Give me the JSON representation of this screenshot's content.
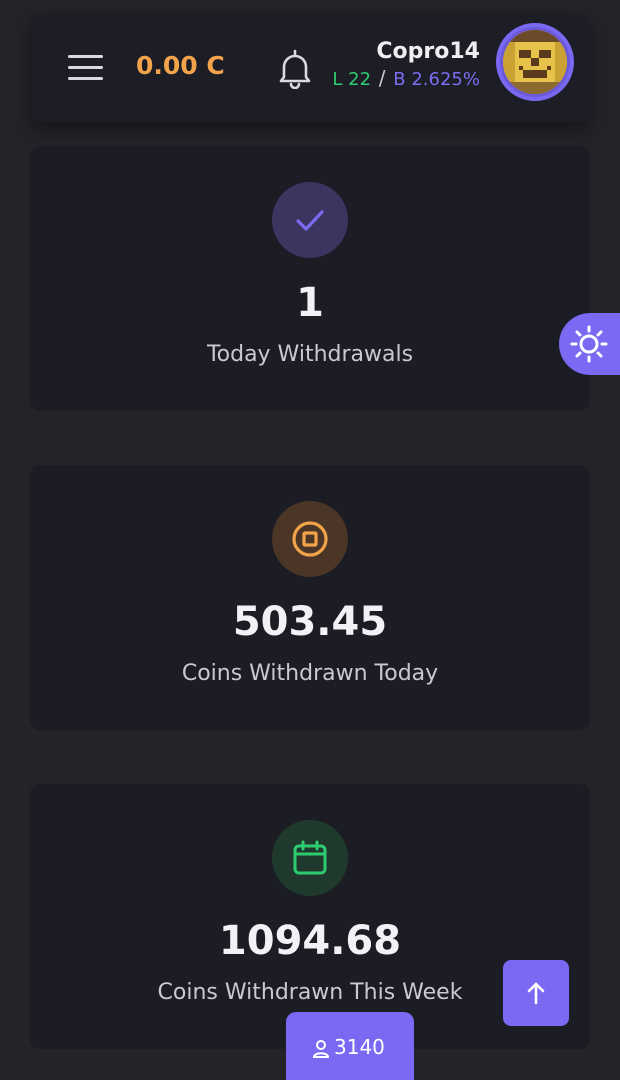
{
  "header": {
    "balance": "0.00 C",
    "username": "Copro14",
    "level": "L 22",
    "separator": "/",
    "bonus": "B 2.625%"
  },
  "stats": [
    {
      "value": "1",
      "label": "Today Withdrawals",
      "icon": "check-icon",
      "color": "#7c6cf0"
    },
    {
      "value": "503.45",
      "label": "Coins Withdrawn Today",
      "icon": "coin-icon",
      "color": "#f3a34a"
    },
    {
      "value": "1094.68",
      "label": "Coins Withdrawn This Week",
      "icon": "calendar-icon",
      "color": "#2ecc71"
    }
  ],
  "online": {
    "count": "3140",
    "icon": "user-icon"
  },
  "colors": {
    "accent": "#7b68f3",
    "balance": "#f3a34a",
    "level": "#2ecc71",
    "bonus": "#7c6cf0",
    "card_bg": "#1c1c25",
    "page_bg": "#232328"
  }
}
